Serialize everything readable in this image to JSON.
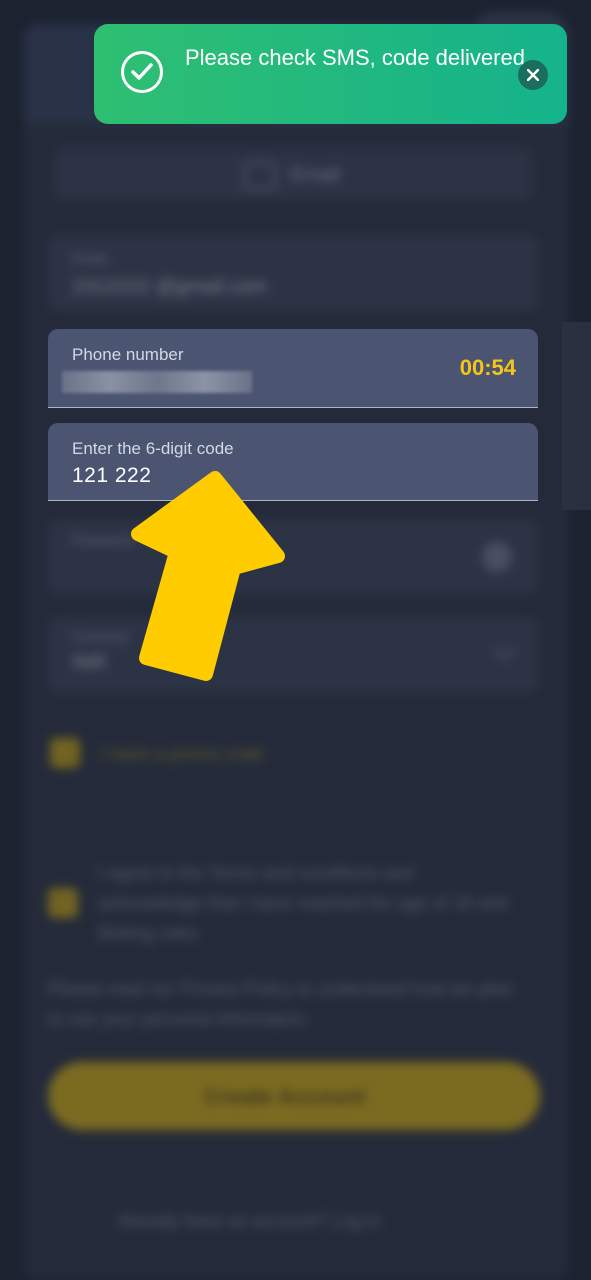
{
  "background_form": {
    "tab_label": "Email",
    "email_label": "Email",
    "email_value": "2312222 @gmail.com",
    "password_label": "Password",
    "currency_label": "Currency",
    "currency_value": "INR",
    "promo_label": "I have a promo code",
    "terms_text": "I agree to the Terms and conditions and acknowledge that I have reached the age of 18 and Betting rules",
    "privacy_text": "Please read our Privacy Policy to understand how we plan to use your personal information.",
    "create_button": "Create Account",
    "login_prompt": "Already have an account? Log in"
  },
  "phone_field": {
    "label": "Phone number",
    "timer": "00:54"
  },
  "code_field": {
    "label": "Enter the 6-digit code",
    "value": "121 222"
  },
  "toast": {
    "message": "Please check SMS, code delivered",
    "icon": "check-circle-icon",
    "close_icon": "close-icon"
  },
  "annotation": {
    "arrow_color": "#ffcc00"
  },
  "colors": {
    "timer": "#f5c518",
    "toast_green": "#2fbf71",
    "accent_yellow": "#f5c518"
  }
}
